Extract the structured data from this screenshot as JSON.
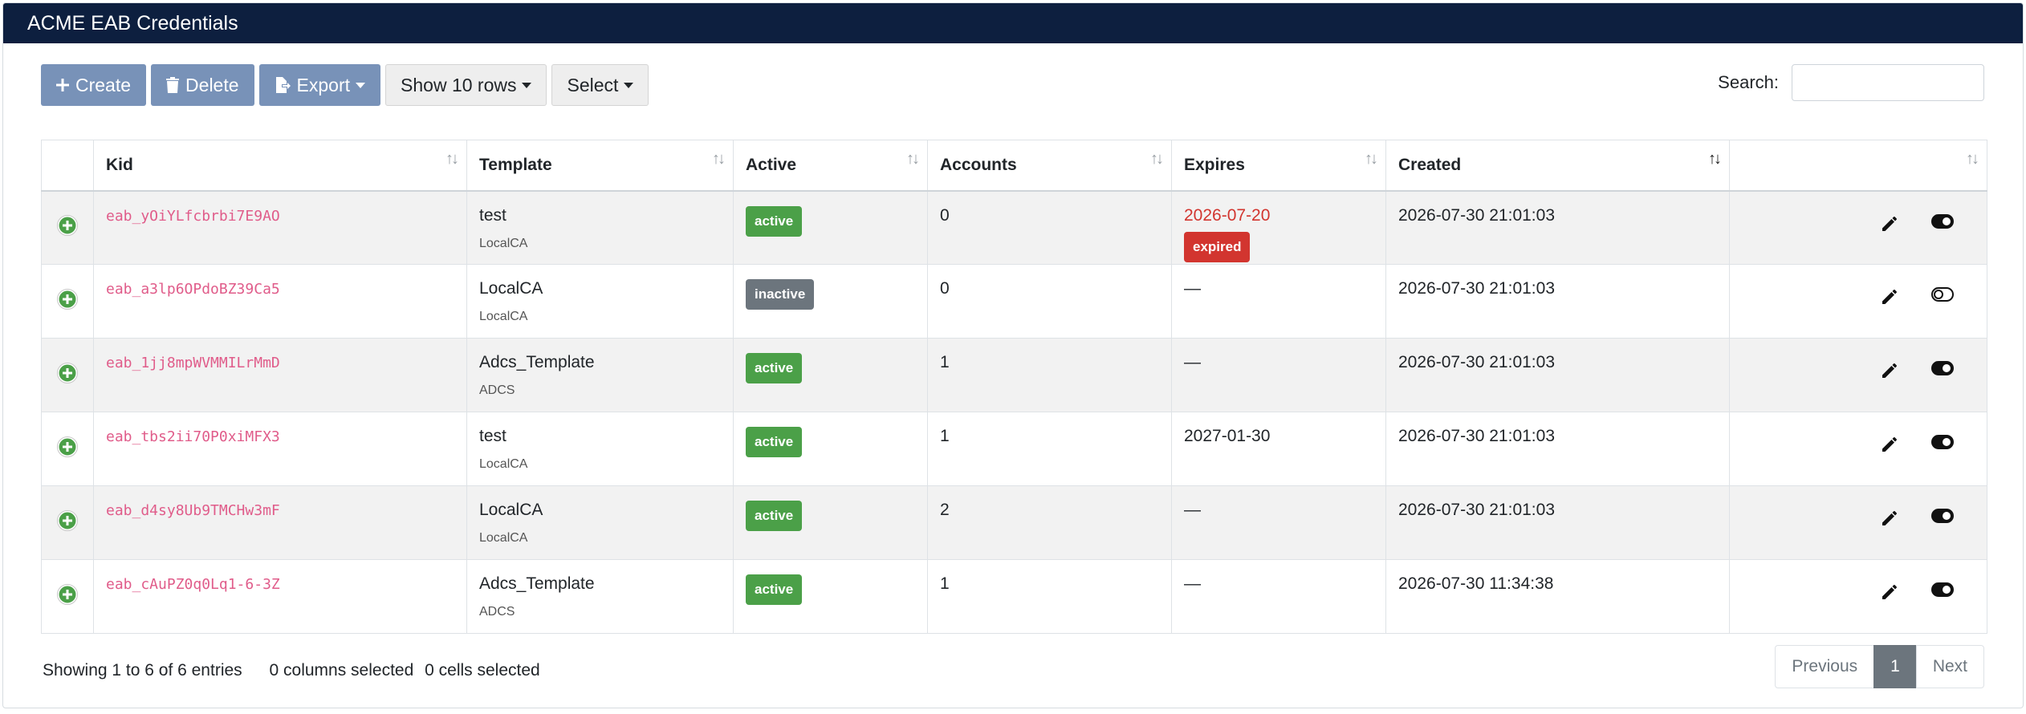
{
  "header": {
    "title": "ACME EAB Credentials"
  },
  "toolbar": {
    "create_label": "Create",
    "delete_label": "Delete",
    "export_label": "Export",
    "rows_label": "Show 10 rows",
    "select_label": "Select"
  },
  "search": {
    "label": "Search:",
    "value": ""
  },
  "columns": [
    "Kid",
    "Template",
    "Active",
    "Accounts",
    "Expires",
    "Created"
  ],
  "rows": [
    {
      "kid": "eab_yOiYLfcbrbi7E9AO",
      "template": "test",
      "ca": "LocalCA",
      "status": "active",
      "accounts": "0",
      "expires": "2026-07-20",
      "expired_badge": "expired",
      "created": "2026-07-30 21:01:03",
      "toggle": "on"
    },
    {
      "kid": "eab_a3lp6OPdoBZ39Ca5",
      "template": "LocalCA",
      "ca": "LocalCA",
      "status": "inactive",
      "accounts": "0",
      "expires": "—",
      "expired_badge": "",
      "created": "2026-07-30 21:01:03",
      "toggle": "off"
    },
    {
      "kid": "eab_1jj8mpWVMMILrMmD",
      "template": "Adcs_Template",
      "ca": "ADCS",
      "status": "active",
      "accounts": "1",
      "expires": "—",
      "expired_badge": "",
      "created": "2026-07-30 21:01:03",
      "toggle": "on"
    },
    {
      "kid": "eab_tbs2ii70P0xiMFX3",
      "template": "test",
      "ca": "LocalCA",
      "status": "active",
      "accounts": "1",
      "expires": "2027-01-30",
      "expired_badge": "",
      "created": "2026-07-30 21:01:03",
      "toggle": "on"
    },
    {
      "kid": "eab_d4sy8Ub9TMCHw3mF",
      "template": "LocalCA",
      "ca": "LocalCA",
      "status": "active",
      "accounts": "2",
      "expires": "—",
      "expired_badge": "",
      "created": "2026-07-30 21:01:03",
      "toggle": "on"
    },
    {
      "kid": "eab_cAuPZ0q0Lq1-6-3Z",
      "template": "Adcs_Template",
      "ca": "ADCS",
      "status": "active",
      "accounts": "1",
      "expires": "—",
      "expired_badge": "",
      "created": "2026-07-30 11:34:38",
      "toggle": "on"
    }
  ],
  "footer": {
    "info": "Showing 1 to 6 of 6 entries",
    "columns_selected": "0 columns selected",
    "cells_selected": "0 cells selected"
  },
  "pagination": {
    "previous": "Previous",
    "current": "1",
    "next": "Next"
  },
  "icons": {
    "create": "plus-icon",
    "delete": "trash-icon",
    "export": "export-icon",
    "row_control": "plus-circle-icon",
    "edit": "pencil-icon",
    "toggle": "toggle-icon"
  },
  "colors": {
    "header_bg": "#0d1f3f",
    "primary_button": "#7892b8",
    "active_badge": "#4ba048",
    "inactive_badge": "#6c757d",
    "expired": "#d2352f",
    "kid_text": "#e05c8a"
  }
}
